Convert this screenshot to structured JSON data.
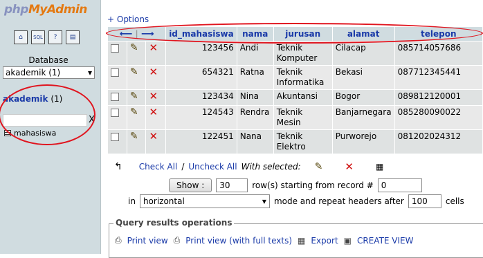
{
  "sidebar": {
    "logo": {
      "php": "php",
      "my": "My",
      "admin": "Admin"
    },
    "icons": [
      "home-icon",
      "sql-icon",
      "help-icon",
      "query-window-icon"
    ],
    "icon_glyphs": [
      "⌂",
      "SQL",
      "?",
      "▤"
    ],
    "database_label": "Database",
    "database_select": "akademik (1)",
    "db_name": "akademik",
    "db_count": "(1)",
    "filter_clear": "X",
    "table": "mahasiswa"
  },
  "main": {
    "options": "+ Options",
    "columns": [
      "id_mahasiswa",
      "nama",
      "jurusan",
      "alamat",
      "telepon"
    ],
    "rows": [
      {
        "id": "123456",
        "nama": "Andi",
        "jurusan": [
          "Teknik",
          "Komputer"
        ],
        "alamat": "Cilacap",
        "telepon": "085714057686"
      },
      {
        "id": "654321",
        "nama": "Ratna",
        "jurusan": [
          "Teknik",
          "Informatika"
        ],
        "alamat": "Bekasi",
        "telepon": "087712345441"
      },
      {
        "id": "123434",
        "nama": "Nina",
        "jurusan": [
          "Akuntansi"
        ],
        "alamat": "Bogor",
        "telepon": "089812120001"
      },
      {
        "id": "124543",
        "nama": "Rendra",
        "jurusan": [
          "Teknik",
          "Mesin"
        ],
        "alamat": "Banjarnegara",
        "telepon": "085280090022"
      },
      {
        "id": "122451",
        "nama": "Nana",
        "jurusan": [
          "Teknik",
          "Elektro"
        ],
        "alamat": "Purworejo",
        "telepon": "081202024312"
      }
    ],
    "bulk": {
      "check_all": "Check All",
      "separator": "/",
      "uncheck_all": "Uncheck All",
      "with_selected": "With selected:"
    },
    "show": {
      "button": "Show :",
      "rows_value": "30",
      "rows_text": "row(s) starting from record #",
      "start_value": "0"
    },
    "mode": {
      "in_label": "in",
      "orientation": "horizontal",
      "repeat_text": "mode and repeat headers after",
      "repeat_value": "100",
      "cells_label": "cells"
    },
    "query_ops": {
      "legend": "Query results operations",
      "print_view": "Print view",
      "print_view_full": "Print view (with full texts)",
      "export": "Export",
      "create_view": "CREATE VIEW"
    }
  },
  "colors": {
    "link": "#1a3aa8",
    "sidebar_bg": "#d0dce0",
    "annotation": "#e0141e"
  }
}
